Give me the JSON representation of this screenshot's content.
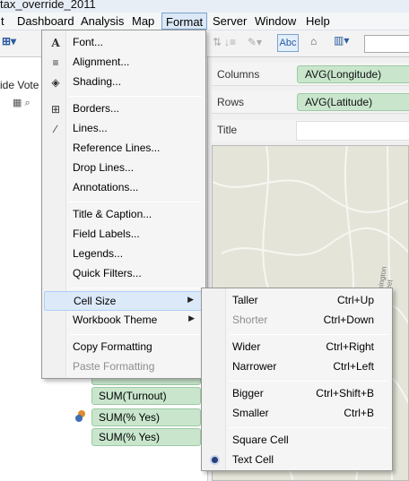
{
  "window": {
    "title": "tax_override_2011"
  },
  "menubar": {
    "items": [
      "t",
      "Dashboard",
      "Analysis",
      "Map",
      "Format",
      "Server",
      "Window",
      "Help"
    ],
    "active": "Format"
  },
  "toolbar": {
    "abc_label": "Abc"
  },
  "left_pane": {
    "partial_text": "ide Vote"
  },
  "shelves": {
    "columns": {
      "label": "Columns",
      "pill": "AVG(Longitude)"
    },
    "rows": {
      "label": "Rows",
      "pill": "AVG(Latitude)"
    },
    "title": {
      "label": "Title"
    }
  },
  "map": {
    "street_label": "Lexington Street"
  },
  "marks": {
    "pills": [
      "SUM(Turnout)",
      "SUM(% Yes)",
      "SUM(% Yes)"
    ]
  },
  "format_menu": {
    "items": [
      {
        "label": "Font...",
        "icon": "font-icon"
      },
      {
        "label": "Alignment...",
        "icon": "alignment-icon"
      },
      {
        "label": "Shading...",
        "icon": "shading-icon"
      },
      {
        "label": "Borders...",
        "icon": "borders-icon"
      },
      {
        "label": "Lines...",
        "icon": "lines-icon"
      },
      {
        "label": "Reference Lines..."
      },
      {
        "label": "Drop Lines..."
      },
      {
        "label": "Annotations..."
      },
      {
        "label": "Title & Caption..."
      },
      {
        "label": "Field Labels..."
      },
      {
        "label": "Legends..."
      },
      {
        "label": "Quick Filters..."
      },
      {
        "label": "Cell Size",
        "submenu": true
      },
      {
        "label": "Workbook Theme",
        "submenu": true
      },
      {
        "label": "Copy Formatting"
      },
      {
        "label": "Paste Formatting",
        "disabled": true
      }
    ]
  },
  "cell_size_menu": {
    "items": [
      {
        "label": "Taller",
        "shortcut": "Ctrl+Up"
      },
      {
        "label": "Shorter",
        "shortcut": "Ctrl+Down",
        "disabled": true
      },
      {
        "label": "Wider",
        "shortcut": "Ctrl+Right"
      },
      {
        "label": "Narrower",
        "shortcut": "Ctrl+Left"
      },
      {
        "label": "Bigger",
        "shortcut": "Ctrl+Shift+B"
      },
      {
        "label": "Smaller",
        "shortcut": "Ctrl+B"
      },
      {
        "label": "Square Cell"
      },
      {
        "label": "Text Cell",
        "selected": true
      }
    ]
  },
  "colors": {
    "pill_green": "#c9e6cd",
    "menu_highlight": "#dce9f8",
    "active_menu": "#dbe8f7"
  }
}
